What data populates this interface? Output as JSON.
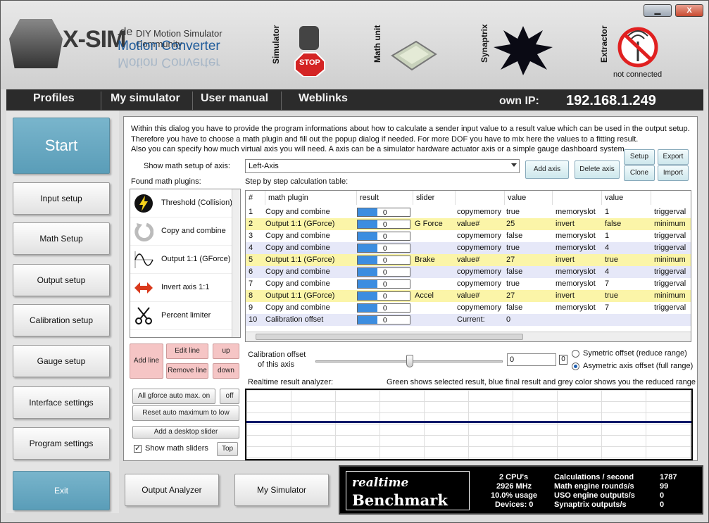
{
  "window": {
    "minimize": "▁",
    "close": "X"
  },
  "logo": {
    "brand": "X-SIM",
    "domain": ".de",
    "community": "DIY Motion Simulator Community",
    "product": "Motion Converter"
  },
  "status": {
    "simulator_label": "Simulator",
    "math_unit_label": "Math unit",
    "synaptrix_label": "Synaptrix",
    "extractor_label": "Extractor",
    "stop_text": "STOP",
    "extractor_status": "not connected"
  },
  "nav": {
    "profiles": "Profiles",
    "my_simulator": "My simulator",
    "user_manual": "User manual",
    "weblinks": "Weblinks",
    "own_ip_label": "own IP:",
    "own_ip": "192.168.1.249"
  },
  "sidebar": {
    "start": "Start",
    "input_setup": "Input setup",
    "math_setup": "Math Setup",
    "output_setup": "Output setup",
    "calibration_setup": "Calibration setup",
    "gauge_setup": "Gauge setup",
    "interface_settings": "Interface settings",
    "program_settings": "Program settings",
    "exit": "Exit"
  },
  "main": {
    "desc1": "Within this dialog you have to provide the program informations about how to calculate a sender input value to a result value which can be used in the output setup.",
    "desc2": "Therefore you have to choose a math plugin and fill out the popup dialog if needed. For more DOF you have to mix here the values to a fitting result.",
    "desc3": "Also you can specify how much virtual axis you will need. A axis can be a simulator hardware actuator axis or a simple gauge dashboard system.",
    "show_axis_label": "Show math setup of axis:",
    "axis_value": "Left-Axis",
    "add_axis": "Add axis",
    "delete_axis": "Delete axis",
    "setup": "Setup",
    "export": "Export",
    "clone": "Clone",
    "import": "Import",
    "found_plugins_label": "Found math plugins:",
    "step_table_label": "Step by step calculation table:"
  },
  "plugins": [
    {
      "icon": "lightning-icon",
      "label": "Threshold (Collision)"
    },
    {
      "icon": "refresh-icon",
      "label": "Copy and combine"
    },
    {
      "icon": "sine-wave-icon",
      "label": "Output 1:1 (GForce)"
    },
    {
      "icon": "invert-arrows-icon",
      "label": "Invert axis 1:1"
    },
    {
      "icon": "scissors-icon",
      "label": "Percent limiter"
    }
  ],
  "table": {
    "headers": [
      "#",
      "math plugin",
      "result",
      "slider",
      "",
      "value",
      "",
      "value",
      ""
    ],
    "rows": [
      {
        "n": "1",
        "plugin": "Copy and combine",
        "result": "0",
        "slider": "",
        "p1": "copymemory",
        "v1": "true",
        "p2": "memoryslot",
        "v2": "1",
        "p3": "triggerval",
        "hl": false
      },
      {
        "n": "2",
        "plugin": "Output 1:1 (GForce)",
        "result": "0",
        "slider": "G Force",
        "p1": "value#",
        "v1": "25",
        "p2": "invert",
        "v2": "false",
        "p3": "minimum",
        "hl": true
      },
      {
        "n": "3",
        "plugin": "Copy and combine",
        "result": "0",
        "slider": "",
        "p1": "copymemory",
        "v1": "false",
        "p2": "memoryslot",
        "v2": "1",
        "p3": "triggerval",
        "hl": false
      },
      {
        "n": "4",
        "plugin": "Copy and combine",
        "result": "0",
        "slider": "",
        "p1": "copymemory",
        "v1": "true",
        "p2": "memoryslot",
        "v2": "4",
        "p3": "triggerval",
        "hl": false
      },
      {
        "n": "5",
        "plugin": "Output 1:1 (GForce)",
        "result": "0",
        "slider": "Brake",
        "p1": "value#",
        "v1": "27",
        "p2": "invert",
        "v2": "true",
        "p3": "minimum",
        "hl": true
      },
      {
        "n": "6",
        "plugin": "Copy and combine",
        "result": "0",
        "slider": "",
        "p1": "copymemory",
        "v1": "false",
        "p2": "memoryslot",
        "v2": "4",
        "p3": "triggerval",
        "hl": false
      },
      {
        "n": "7",
        "plugin": "Copy and combine",
        "result": "0",
        "slider": "",
        "p1": "copymemory",
        "v1": "true",
        "p2": "memoryslot",
        "v2": "7",
        "p3": "triggerval",
        "hl": false
      },
      {
        "n": "8",
        "plugin": "Output 1:1 (GForce)",
        "result": "0",
        "slider": "Accel",
        "p1": "value#",
        "v1": "27",
        "p2": "invert",
        "v2": "true",
        "p3": "minimum",
        "hl": true
      },
      {
        "n": "9",
        "plugin": "Copy and combine",
        "result": "0",
        "slider": "",
        "p1": "copymemory",
        "v1": "false",
        "p2": "memoryslot",
        "v2": "7",
        "p3": "triggerval",
        "hl": false
      },
      {
        "n": "10",
        "plugin": "Calibration offset",
        "result": "0",
        "slider": "",
        "p1": "Current:",
        "v1": "0",
        "p2": "",
        "v2": "",
        "p3": "",
        "hl": false
      }
    ]
  },
  "controls": {
    "add_line": "Add line",
    "edit_line": "Edit line",
    "up": "up",
    "remove_line": "Remove line",
    "down": "down",
    "gforce_auto": "All gforce auto max. on",
    "off": "off",
    "reset_auto": "Reset auto maximum to low",
    "add_desktop_slider": "Add a desktop slider",
    "show_math_sliders": "Show math sliders",
    "top": "Top"
  },
  "calibration": {
    "label1": "Calibration offset",
    "label2": "of this axis",
    "value": "0",
    "small_value": "0",
    "symmetric": "Symetric offset (reduce range)",
    "asymmetric": "Asymetric axis offset (full range)",
    "slider_level": 0.5
  },
  "analyzer": {
    "label": "Realtime result analyzer:",
    "hint": "Green shows selected result, blue final result and grey color shows you the reduced range"
  },
  "bottom": {
    "output_analyzer": "Output Analyzer",
    "my_simulator": "My Simulator"
  },
  "benchmark": {
    "title1": "realtime",
    "title2": "Benchmark",
    "cpus": "2 CPU's",
    "mhz": "2926 MHz",
    "usage": "10.0% usage",
    "devices": "Devices: 0",
    "calc_label": "Calculations / second",
    "calc_val": "1787",
    "rounds_label": "Math engine rounds/s",
    "rounds_val": "99",
    "uso_label": "USO engine outputs/s",
    "uso_val": "0",
    "syn_label": "Synaptrix outputs/s",
    "syn_val": "0"
  },
  "colors": {
    "accent_blue": "#5a9db8",
    "highlight_row": "#fbf5a8",
    "alt_row": "#e6e8f8",
    "nav_bg": "#2b2b2b"
  }
}
